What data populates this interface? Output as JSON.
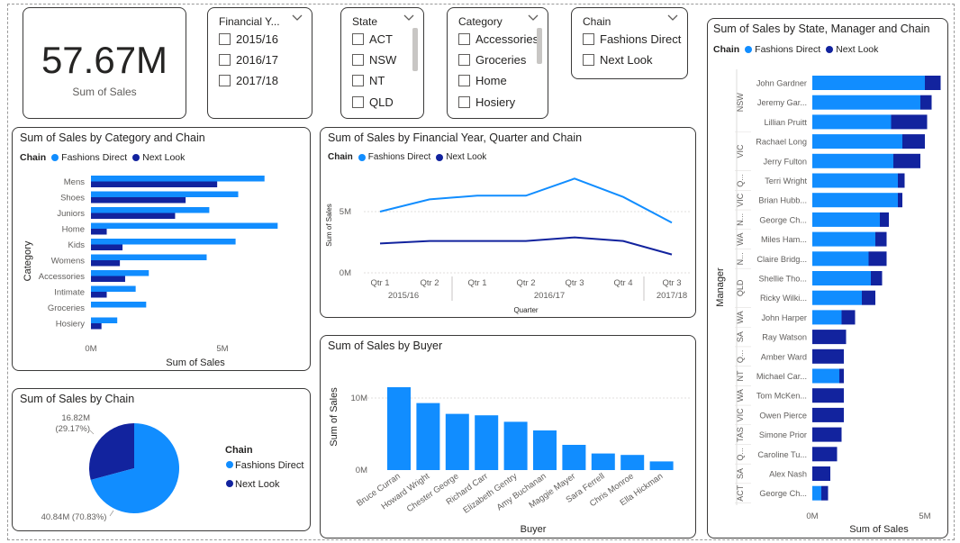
{
  "kpi": {
    "value": "57.67M",
    "label": "Sum of Sales"
  },
  "slicers": {
    "financial_year": {
      "title": "Financial Y...",
      "options": [
        "2015/16",
        "2016/17",
        "2017/18"
      ]
    },
    "state": {
      "title": "State",
      "options": [
        "ACT",
        "NSW",
        "NT",
        "QLD"
      ]
    },
    "category": {
      "title": "Category",
      "options": [
        "Accessories",
        "Groceries",
        "Home",
        "Hosiery"
      ]
    },
    "chain": {
      "title": "Chain",
      "options": [
        "Fashions Direct",
        "Next Look"
      ]
    }
  },
  "legend": {
    "title": "Chain",
    "items": [
      "Fashions Direct",
      "Next Look"
    ]
  },
  "colors": {
    "fashions_direct": "#118dff",
    "next_look": "#12239e",
    "border": "#3b3a39"
  },
  "icons": {
    "slicer_dropdown": "chevron-down-icon"
  },
  "category_chart": {
    "title": "Sum of Sales by Category and Chain",
    "xlabel": "Sum of Sales",
    "ylabel": "Category",
    "xticks": [
      "0M",
      "5M"
    ],
    "chart_data": {
      "type": "bar",
      "orientation": "horizontal",
      "categories": [
        "Mens",
        "Shoes",
        "Juniors",
        "Home",
        "Kids",
        "Womens",
        "Accessories",
        "Intimate",
        "Groceries",
        "Hosiery"
      ],
      "series": [
        {
          "name": "Fashions Direct",
          "values": [
            6.6,
            5.6,
            4.5,
            7.1,
            5.5,
            4.4,
            2.2,
            1.7,
            2.1,
            1.0
          ]
        },
        {
          "name": "Next Look",
          "values": [
            4.8,
            3.6,
            3.2,
            0.6,
            1.2,
            1.1,
            1.3,
            0.6,
            0.0,
            0.4
          ]
        }
      ],
      "xlim": [
        0,
        8
      ]
    }
  },
  "year_chart": {
    "title": "Sum of Sales by Financial Year, Quarter and Chain",
    "xlabel": "Quarter",
    "ylabel": "Sum of Sales",
    "yticks": [
      "5M",
      "0M"
    ],
    "quarters": [
      "Qtr 1",
      "Qtr 2",
      "Qtr 1",
      "Qtr 2",
      "Qtr 3",
      "Qtr 4",
      "Qtr 3"
    ],
    "years": [
      "2015/16",
      "2016/17",
      "2017/18"
    ],
    "chart_data": {
      "type": "line",
      "x": [
        "2015/16 Qtr 1",
        "2015/16 Qtr 2",
        "2016/17 Qtr 1",
        "2016/17 Qtr 2",
        "2016/17 Qtr 3",
        "2016/17 Qtr 4",
        "2017/18 Qtr 3"
      ],
      "series": [
        {
          "name": "Fashions Direct",
          "values": [
            5.0,
            6.0,
            6.3,
            6.3,
            7.7,
            6.2,
            4.1
          ]
        },
        {
          "name": "Next Look",
          "values": [
            2.4,
            2.6,
            2.6,
            2.6,
            2.9,
            2.6,
            1.5
          ]
        }
      ],
      "ylim": [
        0,
        9
      ]
    }
  },
  "buyer_chart": {
    "title": "Sum of Sales by Buyer",
    "xlabel": "Buyer",
    "ylabel": "Sum of Sales",
    "yticks": [
      "10M",
      "0M"
    ],
    "chart_data": {
      "type": "bar",
      "categories": [
        "Bruce Curran",
        "Howard Wright",
        "Chester George",
        "Richard Carr",
        "Elizabeth Gentry",
        "Amy Buchanan",
        "Maggie Mayer",
        "Sara Ferrell",
        "Chris Monroe",
        "Ella Hickman"
      ],
      "values": [
        11.5,
        9.3,
        7.8,
        7.6,
        6.7,
        5.5,
        3.5,
        2.3,
        2.1,
        1.2
      ],
      "ylim": [
        0,
        12.5
      ]
    }
  },
  "pie_chart": {
    "title": "Sum of Sales by Chain",
    "label_next_look": "16.82M\n(29.17%)",
    "label_fashions_direct": "40.84M (70.83%)",
    "chart_data": {
      "type": "pie",
      "slices": [
        {
          "name": "Fashions Direct",
          "value": 40.84,
          "label": "40.84M (70.83%)"
        },
        {
          "name": "Next Look",
          "value": 16.82,
          "label": "16.82M (29.17%)"
        }
      ]
    }
  },
  "manager_chart": {
    "title": "Sum of Sales by State, Manager and Chain",
    "xlabel": "Sum of Sales",
    "ylabel": "Manager",
    "xticks": [
      "0M",
      "5M"
    ],
    "states": [
      {
        "label": "NSW",
        "from": 0,
        "to": 2
      },
      {
        "label": "VIC",
        "from": 3,
        "to": 4
      },
      {
        "label": "Q...",
        "from": 5,
        "to": 5
      },
      {
        "label": "VIC",
        "from": 6,
        "to": 6
      },
      {
        "label": "N...",
        "from": 7,
        "to": 7
      },
      {
        "label": "WA",
        "from": 8,
        "to": 8
      },
      {
        "label": "N...",
        "from": 9,
        "to": 9
      },
      {
        "label": "QLD",
        "from": 10,
        "to": 11
      },
      {
        "label": "WA",
        "from": 12,
        "to": 12
      },
      {
        "label": "SA",
        "from": 13,
        "to": 13
      },
      {
        "label": "Q...",
        "from": 14,
        "to": 14
      },
      {
        "label": "NT",
        "from": 15,
        "to": 15
      },
      {
        "label": "WA",
        "from": 16,
        "to": 16
      },
      {
        "label": "VIC",
        "from": 17,
        "to": 17
      },
      {
        "label": "TAS",
        "from": 18,
        "to": 18
      },
      {
        "label": "Q...",
        "from": 19,
        "to": 19
      },
      {
        "label": "SA",
        "from": 20,
        "to": 20
      },
      {
        "label": "ACT",
        "from": 21,
        "to": 21
      }
    ],
    "chart_data": {
      "type": "bar",
      "orientation": "horizontal",
      "stacked": true,
      "categories": [
        "John Gardner",
        "Jeremy Gar...",
        "Lillian Pruitt",
        "Rachael Long",
        "Jerry Fulton",
        "Terri Wright",
        "Brian Hubb...",
        "George Ch...",
        "Miles Ham...",
        "Claire Bridg...",
        "Shellie Tho...",
        "Ricky Wilki...",
        "John Harper",
        "Ray Watson",
        "Amber Ward",
        "Michael Car...",
        "Tom McKen...",
        "Owen Pierce",
        "Simone Prior",
        "Caroline Tu...",
        "Alex Nash",
        "George Ch..."
      ],
      "series": [
        {
          "name": "Fashions Direct",
          "values": [
            5.0,
            4.8,
            3.5,
            4.0,
            3.6,
            3.8,
            3.8,
            3.0,
            2.8,
            2.5,
            2.6,
            2.2,
            1.3,
            0,
            0,
            1.2,
            0,
            0,
            0,
            0,
            0,
            0.4
          ]
        },
        {
          "name": "Next Look",
          "values": [
            0.7,
            0.5,
            1.6,
            1.0,
            1.2,
            0.3,
            0.2,
            0.4,
            0.5,
            0.8,
            0.5,
            0.6,
            0.6,
            1.5,
            1.4,
            0.2,
            1.4,
            1.4,
            1.3,
            1.1,
            0.8,
            0.3
          ]
        }
      ],
      "xlim": [
        0,
        6
      ]
    }
  }
}
